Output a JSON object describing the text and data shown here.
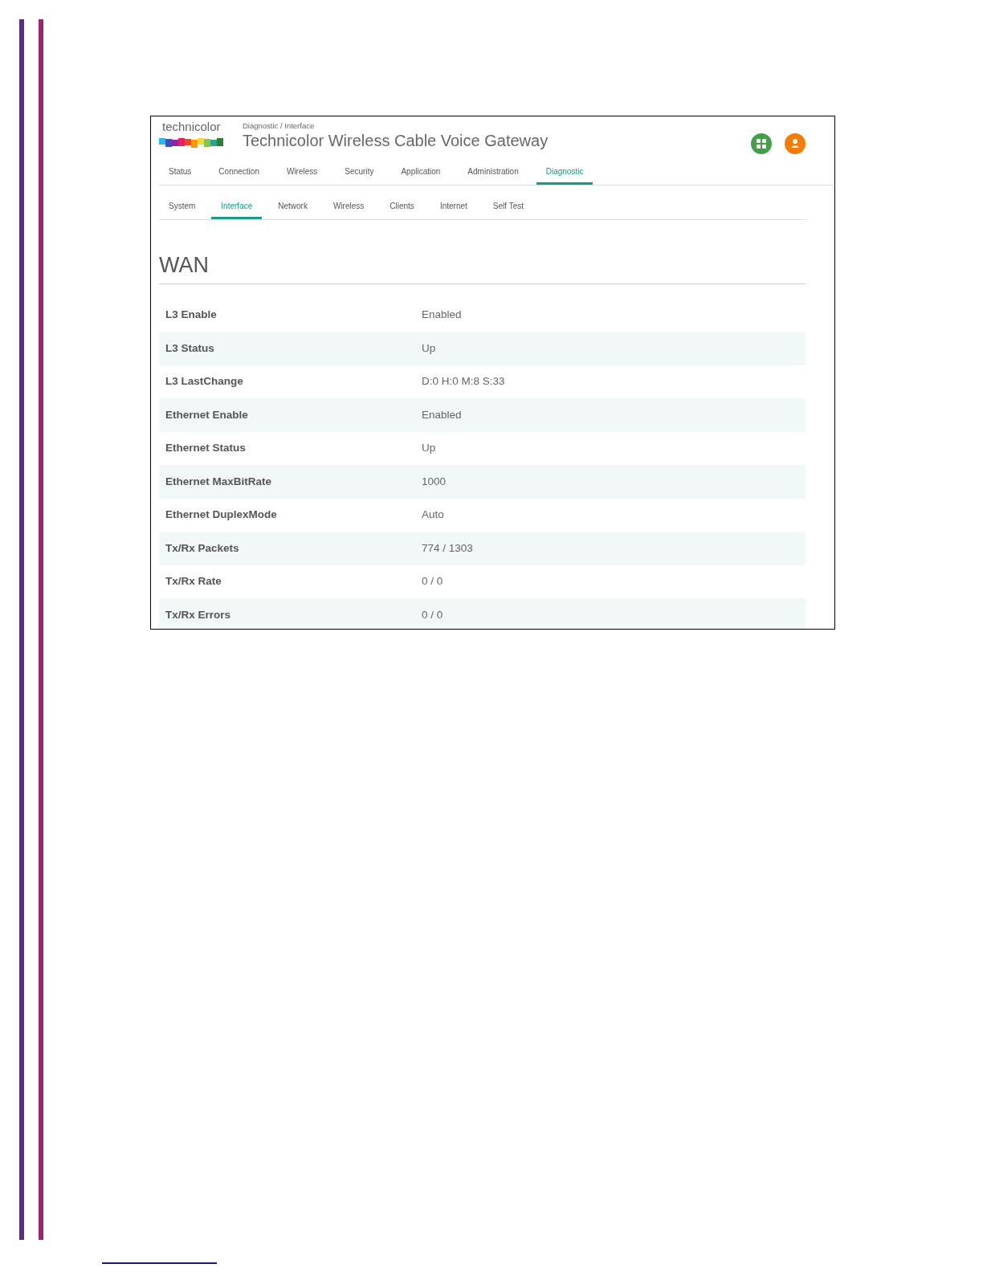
{
  "logo": {
    "text": "technicolor"
  },
  "header": {
    "breadcrumb": "Diagnostic / Interface",
    "title": "Technicolor Wireless Cable Voice Gateway"
  },
  "tabs": [
    {
      "label": "Status",
      "selected": false
    },
    {
      "label": "Connection",
      "selected": false
    },
    {
      "label": "Wireless",
      "selected": false
    },
    {
      "label": "Security",
      "selected": false
    },
    {
      "label": "Application",
      "selected": false
    },
    {
      "label": "Administration",
      "selected": false
    },
    {
      "label": "Diagnostic",
      "selected": true
    }
  ],
  "subtabs": [
    {
      "label": "System",
      "selected": false
    },
    {
      "label": "Interface",
      "selected": true
    },
    {
      "label": "Network",
      "selected": false
    },
    {
      "label": "Wireless",
      "selected": false
    },
    {
      "label": "Clients",
      "selected": false
    },
    {
      "label": "Internet",
      "selected": false
    },
    {
      "label": "Self Test",
      "selected": false
    }
  ],
  "section": {
    "title": "WAN"
  },
  "rows": [
    {
      "label": "L3 Enable",
      "value": "Enabled"
    },
    {
      "label": "L3 Status",
      "value": "Up"
    },
    {
      "label": "L3 LastChange",
      "value": "D:0 H:0 M:8 S:33"
    },
    {
      "label": "Ethernet Enable",
      "value": "Enabled"
    },
    {
      "label": "Ethernet Status",
      "value": "Up"
    },
    {
      "label": "Ethernet MaxBitRate",
      "value": "1000"
    },
    {
      "label": "Ethernet DuplexMode",
      "value": "Auto"
    },
    {
      "label": "Tx/Rx Packets",
      "value": "774 / 1303"
    },
    {
      "label": "Tx/Rx Rate",
      "value": "0 / 0"
    },
    {
      "label": "Tx/Rx Errors",
      "value": "0 / 0"
    }
  ]
}
